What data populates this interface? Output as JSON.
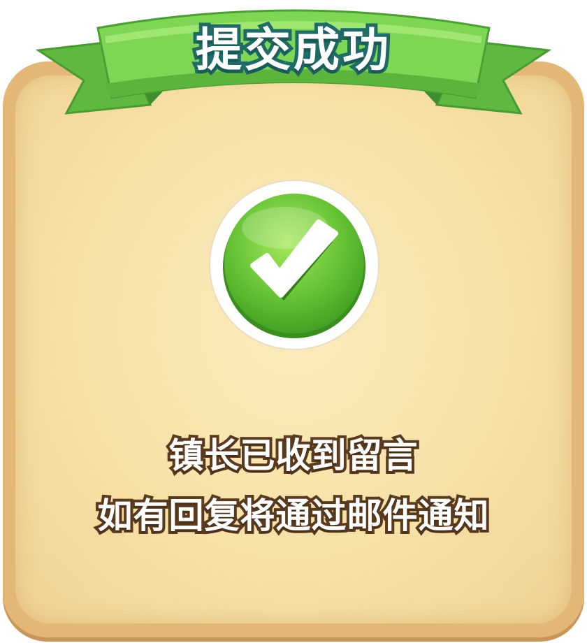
{
  "dialog": {
    "title": "提交成功",
    "message_line1": "镇长已收到留言",
    "message_line2": "如有回复将通过邮件通知",
    "status_icon": "checkmark-icon"
  },
  "colors": {
    "ribbon_green": "#6cc24a",
    "title_outline": "#1f6b66",
    "parchment": "#f6e1a6",
    "frame": "#e3b877",
    "check_green": "#5bbd2e",
    "text_outline": "#5a3a1e"
  }
}
